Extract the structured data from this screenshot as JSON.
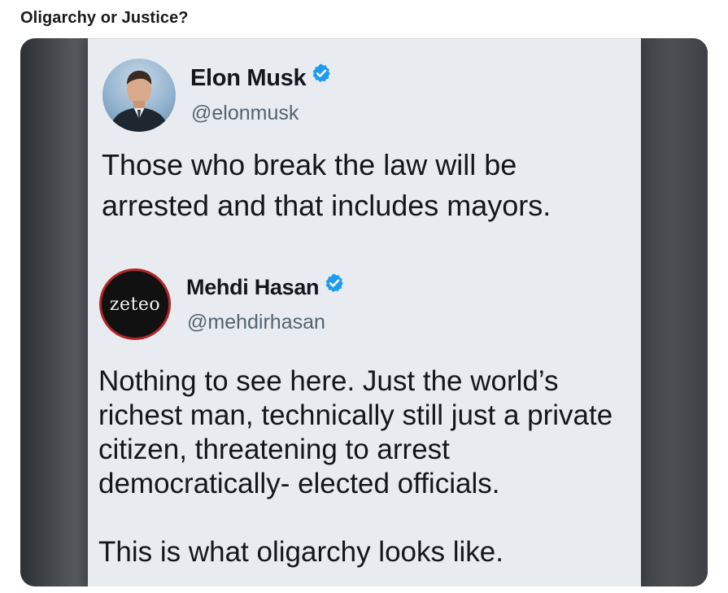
{
  "post": {
    "title": "Oligarchy or Justice?"
  },
  "tweets": [
    {
      "name": "Elon Musk",
      "handle": "@elonmusk",
      "verified": true,
      "text": "Those who break the law will be\narrested and that includes mayors."
    },
    {
      "name": "Mehdi Hasan",
      "handle": "@mehdirhasan",
      "verified": true,
      "avatar_text": "zeteo",
      "text_lines": [
        "Nothing to see here. Just the world’s richest man, technically still just a private citizen,  threatening to arrest democratically- elected officials.",
        "This is what oligarchy looks like."
      ]
    }
  ],
  "colors": {
    "verified_badge": "#1d9bf0",
    "handle": "#536471",
    "text": "#14171a",
    "zeteo_ring": "#b0262b"
  }
}
